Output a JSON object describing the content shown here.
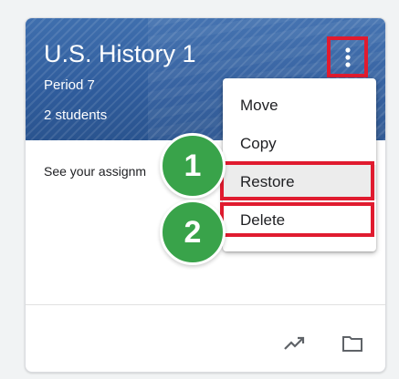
{
  "card": {
    "title": "U.S. History 1",
    "section": "Period 7",
    "students": "2 students",
    "body_text": "See your assignm"
  },
  "menu": {
    "items": [
      {
        "label": "Move"
      },
      {
        "label": "Copy"
      },
      {
        "label": "Restore"
      },
      {
        "label": "Delete"
      }
    ]
  },
  "steps": [
    "1",
    "2"
  ],
  "icons": {
    "more": "more-vert-icon",
    "trend": "trending-up-icon",
    "folder": "folder-icon"
  },
  "colors": {
    "highlight": "#e01b2f",
    "step_badge": "#39a34a",
    "header": "#2f5c9c"
  }
}
